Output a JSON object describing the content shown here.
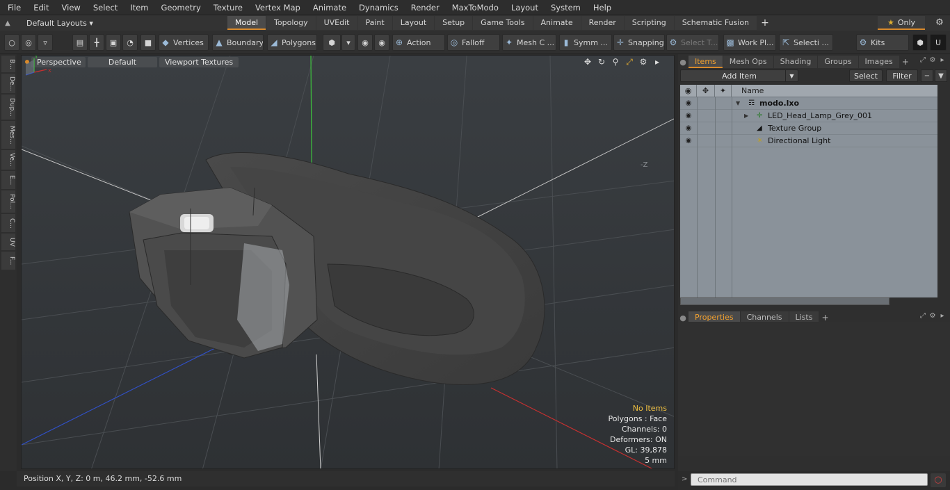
{
  "menu": [
    "File",
    "Edit",
    "View",
    "Select",
    "Item",
    "Geometry",
    "Texture",
    "Vertex Map",
    "Animate",
    "Dynamics",
    "Render",
    "MaxToModo",
    "Layout",
    "System",
    "Help"
  ],
  "layout_selector": "Default Layouts",
  "tabs": [
    "Model",
    "Topology",
    "UVEdit",
    "Paint",
    "Layout",
    "Setup",
    "Game Tools",
    "Animate",
    "Render",
    "Scripting",
    "Schematic Fusion"
  ],
  "active_tab": "Model",
  "only_label": "Only",
  "toolbar": {
    "vertices": "Vertices",
    "boundary": "Boundary",
    "polygons": "Polygons",
    "action": "Action",
    "falloff": "Falloff",
    "mesh_c": "Mesh C ...",
    "symm": "Symm ...",
    "snapping": "Snapping",
    "select_t": "Select T...",
    "work_pl": "Work Pl...",
    "selecti": "Selecti ...",
    "kits": "Kits"
  },
  "left_strip": [
    "B...",
    "De...",
    "Dup...",
    "Mes...",
    "Ve...",
    "E...",
    "Pol...",
    "C...",
    "UV",
    "F..."
  ],
  "viewport": {
    "perspective": "Perspective",
    "default": "Default",
    "viewport_textures": "Viewport Textures",
    "axis_z": "-Z"
  },
  "info": {
    "no_items": "No Items",
    "polygons": "Polygons : Face",
    "channels": "Channels: 0",
    "deformers": "Deformers: ON",
    "gl": "GL: 39,878",
    "unit": "5 mm"
  },
  "status": "Position X, Y, Z:   0 m, 46.2 mm, -52.6 mm",
  "panel_tabs": [
    "Items",
    "Mesh Ops",
    "Shading",
    "Groups",
    "Images"
  ],
  "add_item": "Add Item",
  "select_btn": "Select",
  "filter_btn": "Filter",
  "tree_header": {
    "name": "Name"
  },
  "tree_items": [
    "modo.lxo",
    "LED_Head_Lamp_Grey_001",
    "Texture Group",
    "Directional Light"
  ],
  "props_tabs": [
    "Properties",
    "Channels",
    "Lists"
  ],
  "command_placeholder": "Command",
  "colors": {
    "accent": "#d98a2b",
    "viewport_bg": "#3c4044",
    "panel_bg": "#2f2f2f"
  }
}
